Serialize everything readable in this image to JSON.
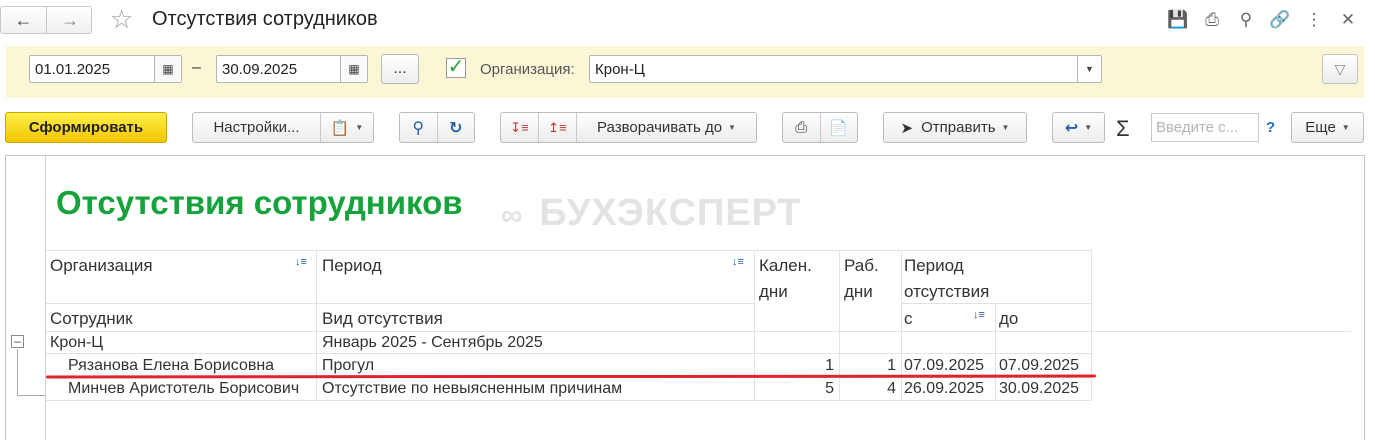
{
  "window": {
    "title": "Отсутствия сотрудников"
  },
  "filters": {
    "date_from": "01.01.2025",
    "date_sep": "–",
    "date_to": "30.09.2025",
    "dots_label": "...",
    "org_checkbox_checked": true,
    "org_label": "Организация:",
    "org_value": "Крон-Ц"
  },
  "toolbar": {
    "generate": "Сформировать",
    "settings": "Настройки...",
    "expand_to": "Разворачивать до",
    "send": "Отправить",
    "search_placeholder": "Введите с...",
    "help": "?",
    "more": "Еще"
  },
  "report": {
    "title": "Отсутствия сотрудников",
    "watermark": "БУХЭКСПЕРТ",
    "headers": {
      "org": "Организация",
      "period": "Период",
      "cal_days_1": "Кален.",
      "cal_days_2": "дни",
      "work_days_1": "Раб.",
      "work_days_2": "дни",
      "absence_period_1": "Период",
      "absence_period_2": "отсутствия",
      "employee": "Сотрудник",
      "absence_type": "Вид отсутствия",
      "from": "с",
      "to": "до"
    },
    "group": {
      "org": "Крон-Ц",
      "period": "Январь 2025 - Сентябрь 2025"
    },
    "rows": [
      {
        "employee": "Рязанова Елена Борисовна",
        "type": "Прогул",
        "cal": "1",
        "work": "1",
        "from": "07.09.2025",
        "to": "07.09.2025"
      },
      {
        "employee": "Минчев Аристотель Борисович",
        "type": "Отсутствие по невыясненным причинам",
        "cal": "5",
        "work": "4",
        "from": "26.09.2025",
        "to": "30.09.2025"
      }
    ]
  },
  "colors": {
    "title_green": "#16a33c",
    "primary_yellow": "#f2c500",
    "filter_bg": "#fbf7d6",
    "highlight_red": "#e0242e"
  }
}
